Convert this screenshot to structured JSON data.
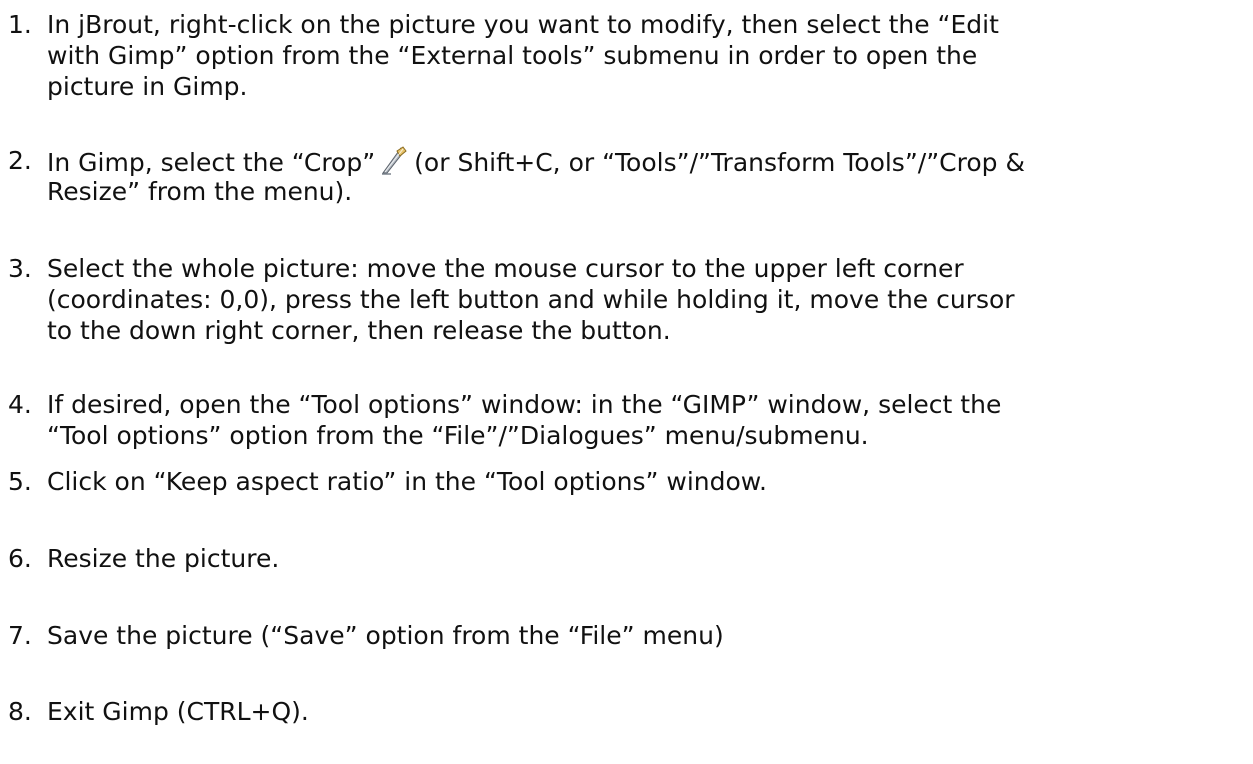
{
  "steps": [
    {
      "number": "1.",
      "lines": [
        "In jBrout, right-click on the picture you want to modify, then select the “Edit",
        "with Gimp” option from the “External tools” submenu in order to open the",
        "picture in Gimp."
      ]
    },
    {
      "number": "2.",
      "line1_before_icon": "In Gimp, select the “Crop”",
      "icon": "crop-tool-icon",
      "line1_after_icon": "(or Shift+C, or “Tools”/”Transform Tools”/”Crop &",
      "line2": "Resize” from the menu)."
    },
    {
      "number": "3.",
      "lines": [
        "Select the whole picture: move the mouse cursor to the upper left corner",
        "(coordinates: 0,0), press the left button and while holding it, move the cursor",
        "to the down right corner, then release the button."
      ]
    },
    {
      "number": "4.",
      "lines": [
        "If desired, open the “Tool options” window: in the “GIMP” window, select the",
        "“Tool options” option from the “File”/”Dialogues” menu/submenu."
      ]
    },
    {
      "number": "5.",
      "lines": [
        "Click on “Keep aspect ratio” in the “Tool options” window."
      ]
    },
    {
      "number": "6.",
      "lines": [
        "Resize the picture."
      ]
    },
    {
      "number": "7.",
      "lines": [
        "Save the picture (“Save” option from the “File” menu)"
      ]
    },
    {
      "number": "8.",
      "lines": [
        "Exit Gimp (CTRL+Q)."
      ]
    }
  ]
}
